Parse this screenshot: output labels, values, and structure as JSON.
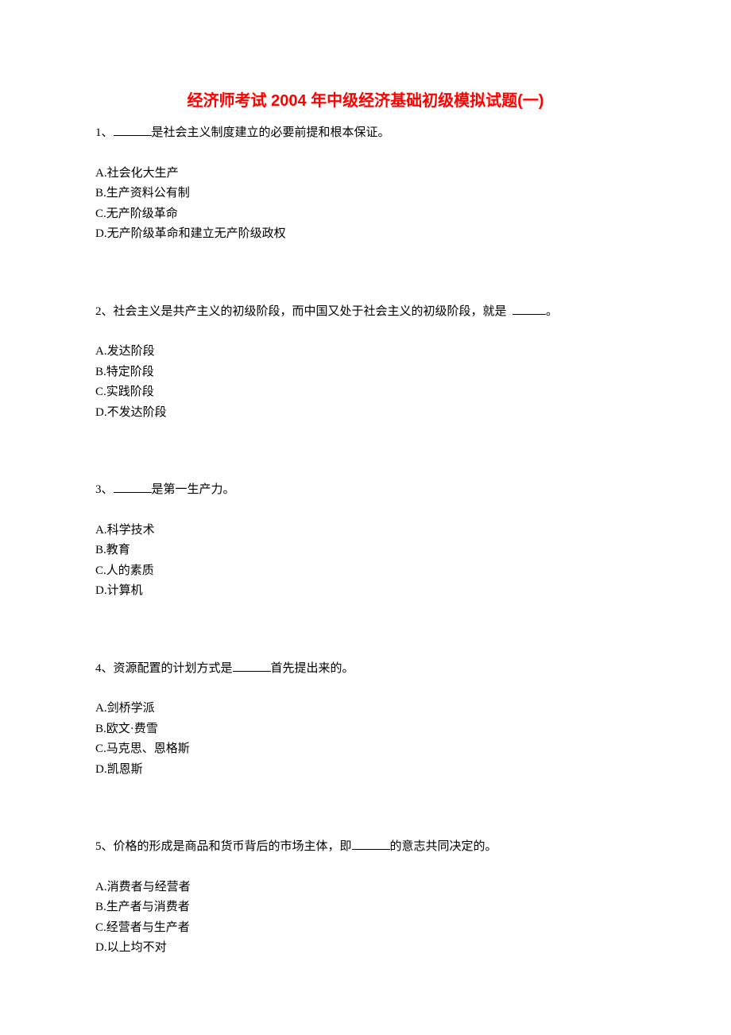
{
  "title": "经济师考试 2004 年中级经济基础初级模拟试题(一)",
  "questions": [
    {
      "num": "1、",
      "pre": "",
      "post": "是社会主义制度建立的必要前提和根本保证。",
      "options": [
        "A.社会化大生产",
        "B.生产资料公有制",
        "C.无产阶级革命",
        "D.无产阶级革命和建立无产阶级政权"
      ]
    },
    {
      "num": "2、",
      "pre": "社会主义是共产主义的初级阶段，而中国又处于社会主义的初级阶段，就是 ",
      "post": "。",
      "options": [
        "A.发达阶段",
        "B.特定阶段",
        "C.实践阶段",
        "D.不发达阶段"
      ]
    },
    {
      "num": "3、",
      "pre": "",
      "post": "是第一生产力。",
      "options": [
        "A.科学技术",
        "B.教育",
        "C.人的素质",
        "D.计算机"
      ]
    },
    {
      "num": "4、",
      "pre": "资源配置的计划方式是",
      "post": "首先提出来的。",
      "options": [
        "A.剑桥学派",
        "B.欧文·费雪",
        "C.马克思、恩格斯",
        "D.凯恩斯"
      ]
    },
    {
      "num": "5、",
      "pre": "价格的形成是商品和货币背后的市场主体，即",
      "post": "的意志共同决定的。",
      "options": [
        "A.消费者与经营者",
        "B.生产者与消费者",
        "C.经营者与生产者",
        "D.以上均不对"
      ]
    }
  ]
}
